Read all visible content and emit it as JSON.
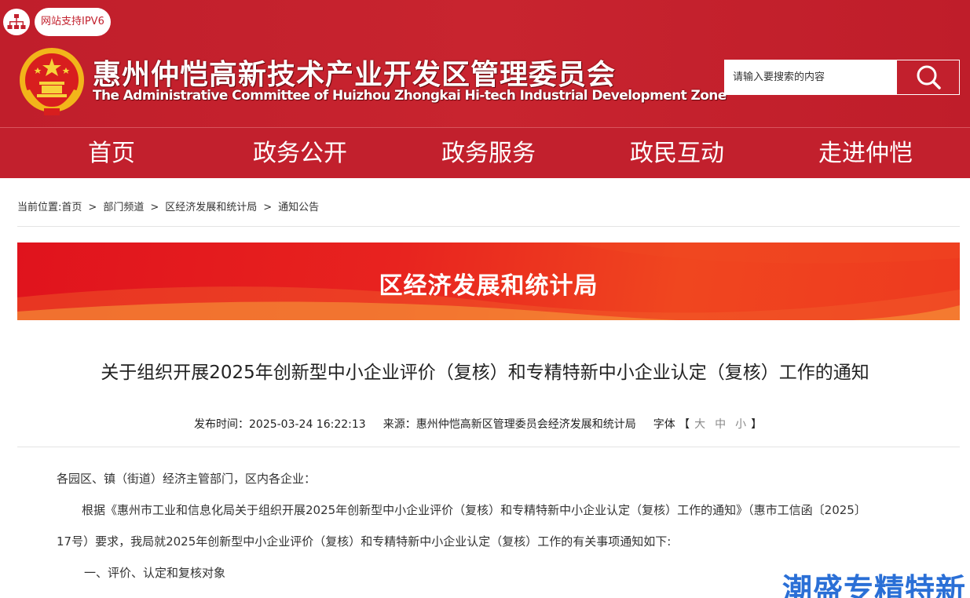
{
  "header": {
    "ipv6_label": "网站支持IPV6",
    "title": "惠州仲恺高新技术产业开发区管理委员会",
    "subtitle": "The Administrative Committee of Huizhou Zhongkai Hi-tech Industrial Development Zone",
    "emblem_icon": "national-emblem-icon",
    "network_icon": "network-icon"
  },
  "search": {
    "placeholder": "请输入要搜索的内容",
    "button_icon": "search-icon"
  },
  "nav": {
    "items": [
      "首页",
      "政务公开",
      "政务服务",
      "政民互动",
      "走进仲恺"
    ]
  },
  "breadcrumb": {
    "prefix": "当前位置:",
    "items": [
      "首页",
      "部门频道",
      "区经济发展和统计局",
      "通知公告"
    ],
    "separator": ">"
  },
  "banner": {
    "title": "区经济发展和统计局"
  },
  "article": {
    "title": "关于组织开展2025年创新型中小企业评价（复核）和专精特新中小企业认定（复核）工作的通知",
    "publish_label": "发布时间：",
    "publish_time": "2025-03-24 16:22:13",
    "source_label": "来源：",
    "source": "惠州仲恺高新区管理委员会经济发展和统计局",
    "font_label": "字体",
    "font_open": "【",
    "font_close": "】",
    "font_large": "大",
    "font_medium": "中",
    "font_small": "小",
    "paragraphs": [
      "各园区、镇（街道）经济主管部门，区内各企业：",
      "根据《惠州市工业和信息化局关于组织开展2025年创新型中小企业评价（复核）和专精特新中小企业认定（复核）工作的通知》（惠市工信函〔2025〕",
      "17号）要求，我局就2025年创新型中小企业评价（复核）和专精特新中小企业认定（复核）工作的有关事项通知如下:",
      "一、评价、认定和复核对象"
    ]
  },
  "watermark": {
    "text": "潮盛专精特新"
  },
  "colors": {
    "brand_red": "#c2202d",
    "banner_red": "#e8231f",
    "watermark_blue": "#2a6fd6"
  }
}
